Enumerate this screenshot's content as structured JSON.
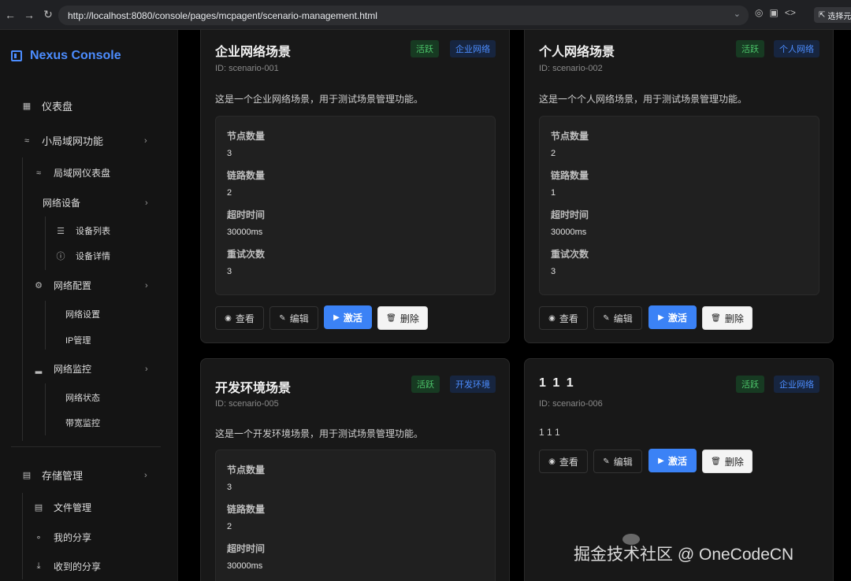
{
  "browser": {
    "url": "http://localhost:8080/console/pages/mcpagent/scenario-management.html",
    "pick_label": "选择元"
  },
  "sidebar": {
    "brand": "Nexus Console",
    "dashboard": "仪表盘",
    "lan": "小局域网功能",
    "lan_dashboard": "局域网仪表盘",
    "net_devices": "网络设备",
    "device_list": "设备列表",
    "device_detail": "设备详情",
    "net_config": "网络配置",
    "net_settings": "网络设置",
    "ip_mgmt": "IP管理",
    "net_monitor": "网络监控",
    "net_status": "网络状态",
    "bandwidth": "带宽监控",
    "storage": "存储管理",
    "files": "文件管理",
    "my_share": "我的分享",
    "received_share": "收到的分享"
  },
  "labels": {
    "nodes": "节点数量",
    "links": "链路数量",
    "timeout": "超时时间",
    "retries": "重试次数",
    "view": "查看",
    "edit": "编辑",
    "activate": "激活",
    "delete": "删除"
  },
  "cards": [
    {
      "title": "企业网络场景",
      "id": "ID: scenario-001",
      "status": "活跃",
      "tag": "企业网络",
      "desc": "这是一个企业网络场景，用于测试场景管理功能。",
      "nodes": "3",
      "links": "2",
      "timeout": "30000ms",
      "retries": "3"
    },
    {
      "title": "个人网络场景",
      "id": "ID: scenario-002",
      "status": "活跃",
      "tag": "个人网络",
      "desc": "这是一个个人网络场景，用于测试场景管理功能。",
      "nodes": "2",
      "links": "1",
      "timeout": "30000ms",
      "retries": "3"
    },
    {
      "title": "开发环境场景",
      "id": "ID: scenario-005",
      "status": "活跃",
      "tag": "开发环境",
      "desc": "这是一个开发环境场景，用于测试场景管理功能。",
      "nodes": "3",
      "links": "2",
      "timeout": "30000ms"
    },
    {
      "title": "1 1 1",
      "id": "ID: scenario-006",
      "status": "活跃",
      "tag": "企业网络",
      "desc": "1 1 1"
    }
  ],
  "watermark": "掘金技术社区 @ OneCodeCN"
}
